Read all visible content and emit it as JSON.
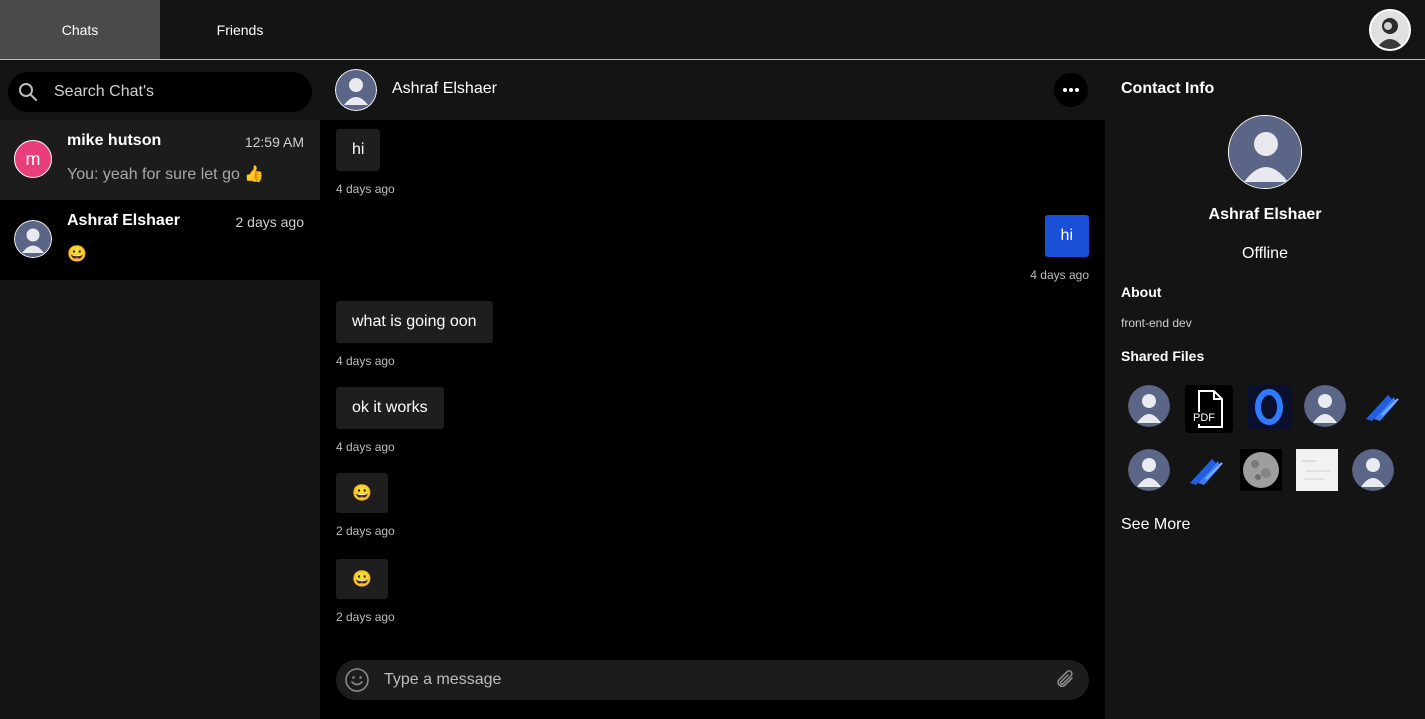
{
  "topbar": {
    "tabs": [
      {
        "label": "Chats",
        "active": true
      },
      {
        "label": "Friends",
        "active": false
      }
    ]
  },
  "sidebar": {
    "search_placeholder": "Search Chat's",
    "chats": [
      {
        "name": "mike hutson",
        "time": "12:59 AM",
        "preview": "You: yeah for sure let go 👍",
        "avatar_letter": "m",
        "avatar_color": "#e83e7a"
      },
      {
        "name": "Ashraf Elshaer",
        "time": "2 days ago",
        "preview": "😀",
        "avatar_icon": "user-silhouette-icon"
      }
    ]
  },
  "conversation": {
    "contact_name": "Ashraf Elshaer",
    "messages": [
      {
        "text": "hi",
        "time": "4 days ago",
        "direction": "in"
      },
      {
        "text": "hi",
        "time": "4 days ago",
        "direction": "out"
      },
      {
        "text": "what is going oon",
        "time": "4 days ago",
        "direction": "in"
      },
      {
        "text": "ok it works",
        "time": "4 days ago",
        "direction": "in"
      },
      {
        "text": "😀",
        "time": "2 days ago",
        "direction": "in"
      },
      {
        "text": "😀",
        "time": "2 days ago",
        "direction": "in"
      }
    ],
    "composer_placeholder": "Type a message"
  },
  "contact_info": {
    "title": "Contact Info",
    "name": "Ashraf Elshaer",
    "status": "Offline",
    "about_heading": "About",
    "about_text": "front-end dev",
    "files_heading": "Shared Files",
    "pdf_label": "PDF",
    "see_more": "See More"
  },
  "colors": {
    "accent_blue": "#1a4fd8",
    "avatar_pink": "#e83e7a",
    "background": "#141414",
    "chat_background": "#000000"
  }
}
